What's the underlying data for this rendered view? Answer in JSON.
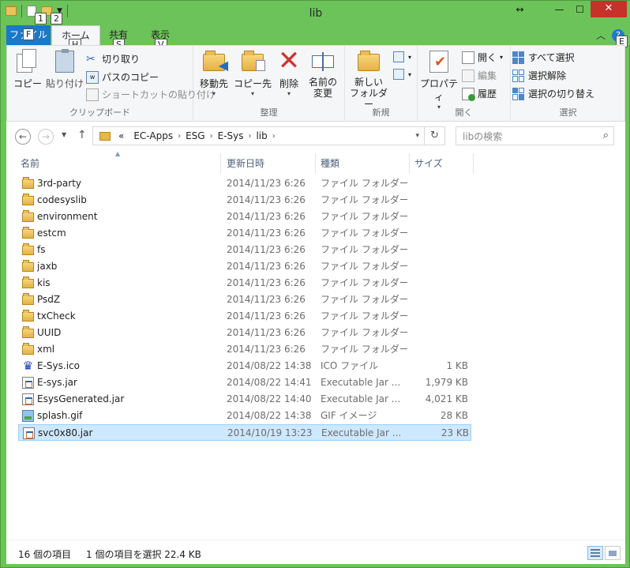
{
  "window": {
    "title": "lib",
    "minimize": "—",
    "maximize": "☐",
    "close": "✕",
    "restore": "↔"
  },
  "qat_keytips": [
    "1",
    "2"
  ],
  "tabs": {
    "file": "ファイル",
    "file_keytip": "F",
    "home": "ホーム",
    "home_keytip": "H",
    "share": "共有",
    "share_keytip": "S",
    "view": "表示",
    "view_keytip": "V",
    "help_keytip": "E"
  },
  "ribbon": {
    "clipboard": {
      "label": "クリップボード",
      "copy": "コピー",
      "paste": "貼り付け",
      "cut": "切り取り",
      "copy_path": "パスのコピー",
      "paste_shortcut": "ショートカットの貼り付け"
    },
    "organize": {
      "label": "整理",
      "move_to": "移動先",
      "copy_to": "コピー先",
      "delete": "削除",
      "rename_1": "名前の",
      "rename_2": "変更"
    },
    "new": {
      "label": "新規",
      "new_folder_1": "新しい",
      "new_folder_2": "フォルダー"
    },
    "open": {
      "label": "開く",
      "properties": "プロパティ",
      "open": "開く",
      "edit": "編集",
      "history": "履歴"
    },
    "select": {
      "label": "選択",
      "select_all": "すべて選択",
      "select_none": "選択解除",
      "invert": "選択の切り替え"
    }
  },
  "address": {
    "prefix": "«",
    "crumbs": [
      "EC-Apps",
      "ESG",
      "E-Sys",
      "lib"
    ],
    "search_placeholder": "libの検索"
  },
  "columns": {
    "name": "名前",
    "date": "更新日時",
    "type": "種類",
    "size": "サイズ"
  },
  "files": [
    {
      "name": "3rd-party",
      "date": "2014/11/23 6:26",
      "type": "ファイル フォルダー",
      "size": "",
      "icon": "folder"
    },
    {
      "name": "codesyslib",
      "date": "2014/11/23 6:26",
      "type": "ファイル フォルダー",
      "size": "",
      "icon": "folder"
    },
    {
      "name": "environment",
      "date": "2014/11/23 6:26",
      "type": "ファイル フォルダー",
      "size": "",
      "icon": "folder"
    },
    {
      "name": "estcm",
      "date": "2014/11/23 6:26",
      "type": "ファイル フォルダー",
      "size": "",
      "icon": "folder"
    },
    {
      "name": "fs",
      "date": "2014/11/23 6:26",
      "type": "ファイル フォルダー",
      "size": "",
      "icon": "folder"
    },
    {
      "name": "jaxb",
      "date": "2014/11/23 6:26",
      "type": "ファイル フォルダー",
      "size": "",
      "icon": "folder"
    },
    {
      "name": "kis",
      "date": "2014/11/23 6:26",
      "type": "ファイル フォルダー",
      "size": "",
      "icon": "folder"
    },
    {
      "name": "PsdZ",
      "date": "2014/11/23 6:26",
      "type": "ファイル フォルダー",
      "size": "",
      "icon": "folder"
    },
    {
      "name": "txCheck",
      "date": "2014/11/23 6:26",
      "type": "ファイル フォルダー",
      "size": "",
      "icon": "folder"
    },
    {
      "name": "UUID",
      "date": "2014/11/23 6:26",
      "type": "ファイル フォルダー",
      "size": "",
      "icon": "folder"
    },
    {
      "name": "xml",
      "date": "2014/11/23 6:26",
      "type": "ファイル フォルダー",
      "size": "",
      "icon": "folder"
    },
    {
      "name": "E-Sys.ico",
      "date": "2014/08/22 14:38",
      "type": "ICO ファイル",
      "size": "1 KB",
      "icon": "ico"
    },
    {
      "name": "E-sys.jar",
      "date": "2014/08/22 14:41",
      "type": "Executable Jar ...",
      "size": "1,979 KB",
      "icon": "jar"
    },
    {
      "name": "EsysGenerated.jar",
      "date": "2014/08/22 14:40",
      "type": "Executable Jar ...",
      "size": "4,021 KB",
      "icon": "jar"
    },
    {
      "name": "splash.gif",
      "date": "2014/08/22 14:38",
      "type": "GIF イメージ",
      "size": "28 KB",
      "icon": "gif"
    },
    {
      "name": "svc0x80.jar",
      "date": "2014/10/19 13:23",
      "type": "Executable Jar ...",
      "size": "23 KB",
      "icon": "jar",
      "selected": true
    }
  ],
  "status": {
    "count": "16 個の項目",
    "selection": "1 個の項目を選択 22.4 KB"
  }
}
